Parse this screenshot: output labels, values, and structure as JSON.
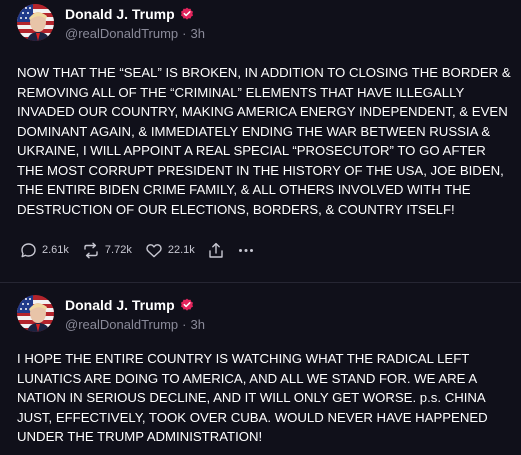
{
  "posts": [
    {
      "display_name": "Donald J. Trump",
      "handle": "@realDonaldTrump",
      "separator": "·",
      "time": "3h",
      "text": "NOW THAT THE “SEAL” IS BROKEN, IN ADDITION TO CLOSING THE BORDER & REMOVING ALL OF THE “CRIMINAL” ELEMENTS THAT HAVE ILLEGALLY INVADED OUR COUNTRY, MAKING AMERICA ENERGY INDEPENDENT, & EVEN DOMINANT AGAIN, & IMMEDIATELY ENDING THE WAR BETWEEN RUSSIA & UKRAINE, I WILL APPOINT A REAL SPECIAL “PROSECUTOR” TO GO AFTER THE MOST CORRUPT PRESIDENT IN THE HISTORY OF THE USA, JOE BIDEN, THE ENTIRE BIDEN CRIME FAMILY, & ALL OTHERS INVOLVED WITH THE DESTRUCTION OF OUR ELECTIONS, BORDERS, & COUNTRY ITSELF!",
      "stats": {
        "replies": "2.61k",
        "retruths": "7.72k",
        "likes": "22.1k"
      },
      "icons": [
        "verified-badge-icon",
        "reply-icon",
        "retruth-icon",
        "like-icon",
        "share-icon",
        "more-icon"
      ]
    },
    {
      "display_name": "Donald J. Trump",
      "handle": "@realDonaldTrump",
      "separator": "·",
      "time": "3h",
      "text": "I HOPE THE ENTIRE COUNTRY IS WATCHING WHAT THE RADICAL LEFT LUNATICS ARE DOING TO AMERICA, AND ALL WE STAND FOR. WE ARE A NATION IN SERIOUS DECLINE, AND IT WILL ONLY GET WORSE. p.s. CHINA JUST, EFFECTIVELY, TOOK OVER CUBA. WOULD NEVER HAVE HAPPENED UNDER THE TRUMP ADMINISTRATION!"
    }
  ],
  "colors": {
    "background": "#10101a",
    "text": "#ffffff",
    "secondary_text": "#8a8a99",
    "verified_badge": "#e3245c",
    "divider": "#262633"
  }
}
